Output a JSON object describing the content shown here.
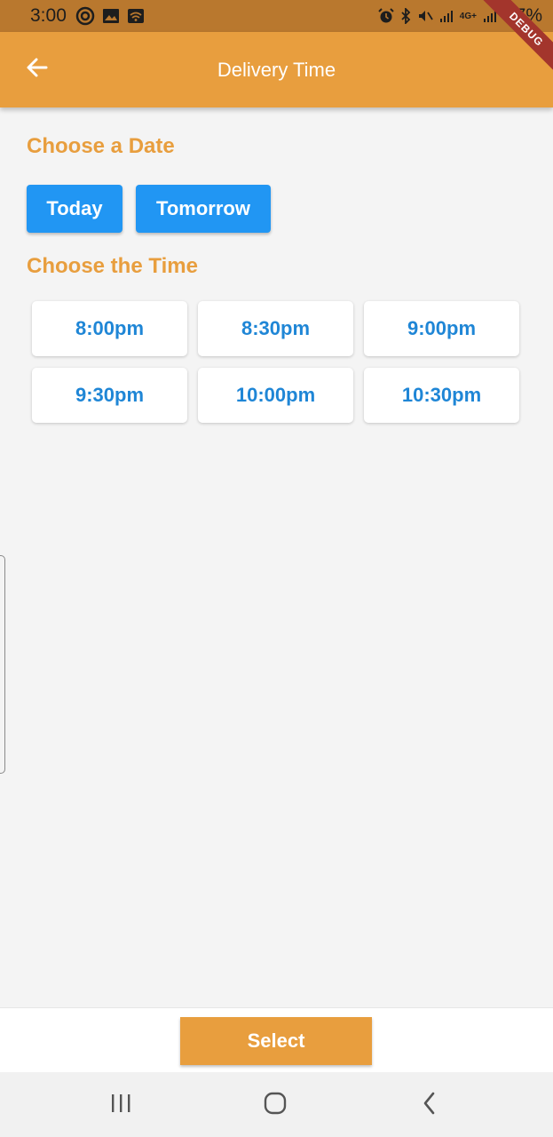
{
  "status_bar": {
    "time": "3:00",
    "battery": "77%",
    "network": "4G+"
  },
  "debug_banner": "DEBUG",
  "app_bar": {
    "title": "Delivery Time",
    "back_icon": "arrow-left-icon"
  },
  "date_section": {
    "title": "Choose a Date",
    "options": [
      "Today",
      "Tomorrow"
    ]
  },
  "time_section": {
    "title": "Choose the Time",
    "slots": [
      "8:00pm",
      "8:30pm",
      "9:00pm",
      "9:30pm",
      "10:00pm",
      "10:30pm"
    ]
  },
  "footer": {
    "select_label": "Select"
  },
  "nav_bar": {
    "icons": [
      "recent-apps-icon",
      "home-icon",
      "back-icon"
    ]
  },
  "colors": {
    "primary": "#e89e3e",
    "accent": "#2196f3",
    "slot_text": "#1f86d6",
    "background": "#f4f4f4",
    "status_bar": "#b9782e",
    "debug_ribbon": "#a3352c"
  }
}
